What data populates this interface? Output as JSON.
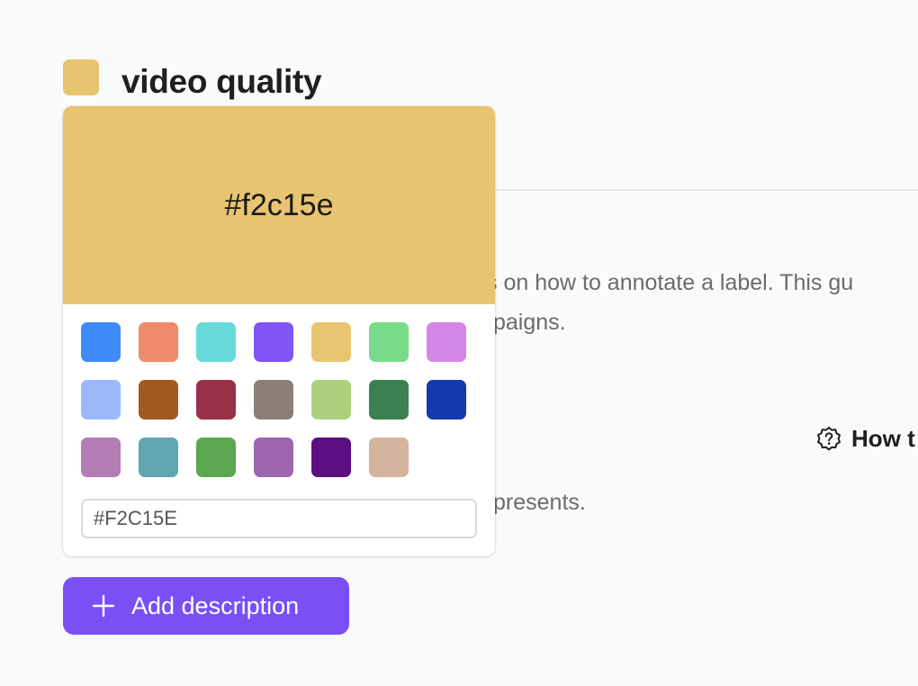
{
  "label": {
    "title": "video quality",
    "color": "#e8c470"
  },
  "background": {
    "line1": "s on how to annotate a label. This gu",
    "line2": "paigns.",
    "line3": "presents.",
    "how_link": "How t"
  },
  "picker": {
    "preview_hex": "#f2c15e",
    "preview_color": "#e8c470",
    "hex_input_value": "#F2C15E",
    "swatches": [
      "#3e8af7",
      "#ef8a6a",
      "#68d9d9",
      "#8155f5",
      "#e9c571",
      "#79db8a",
      "#d486e5",
      "#9bb9fa",
      "#a05b22",
      "#993049",
      "#8c7f74",
      "#acd07d",
      "#3b8051",
      "#1638ad",
      "#b27db5",
      "#5fa6b0",
      "#5ba64f",
      "#9c65ae",
      "#5c0f80",
      "#d4b49e"
    ]
  },
  "add_description": {
    "label": "Add description",
    "color": "#7a4ff5"
  }
}
